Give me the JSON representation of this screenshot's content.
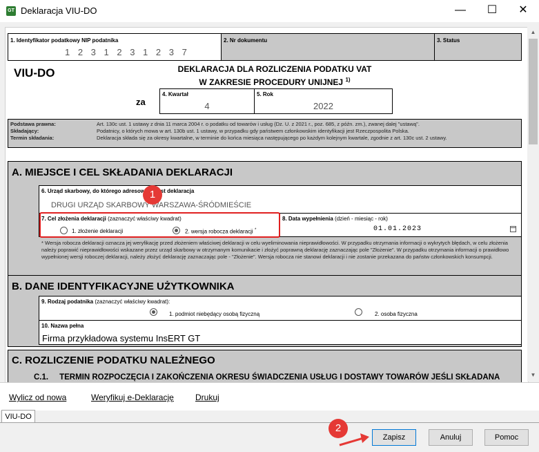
{
  "window": {
    "title": "Deklaracja VIU-DO",
    "icon_text": "GT"
  },
  "form": {
    "field1_label": "1. Identyfikator podatkowy NIP podatnika",
    "field1_value": "1 2 3 1 2 3 1 2 3 7",
    "field2_label": "2. Nr dokumentu",
    "field3_label": "3. Status",
    "form_code": "VIU-DO",
    "title_line1": "DEKLARACJA DLA ROZLICZENIA PODATKU VAT",
    "title_line2": "W ZAKRESIE PROCEDURY UNIJNEJ",
    "title_sup": "1)",
    "za": "za",
    "field4_label": "4. Kwartał",
    "field4_value": "4",
    "field5_label": "5. Rok",
    "field5_value": "2022",
    "legal_basis_label": "Podstawa prawna:",
    "legal_basis_text": "Art. 130c ust. 1 ustawy z dnia 11 marca 2004 r. o podatku od towarów i usług (Dz. U. z 2021 r., poz. 685, z późn. zm.), zwanej dalej \"ustawą\".",
    "filer_label": "Składający:",
    "filer_text": "Podatnicy, o których mowa w art. 130b ust. 1 ustawy, w przypadku gdy państwem członkowskim identyfikacji jest Rzeczpospolita Polska.",
    "deadline_label": "Termin składania:",
    "deadline_text": "Deklaracja składa się za okresy kwartalne, w terminie do końca miesiąca następującego po każdym kolejnym kwartale, zgodnie z art. 130c ust. 2 ustawy.",
    "section_a": "A. MIEJSCE I CEL SKŁADANIA DEKLARACJI",
    "field6_label": "6. Urząd skarbowy, do którego adresowana jest deklaracja",
    "field6_value": "DRUGI URZĄD SKARBOWY WARSZAWA-ŚRÓDMIEŚCIE",
    "field7_label": "7. Cel złożenia deklaracji",
    "field7_hint": "(zaznaczyć właściwy kwadrat)",
    "field7_opt1": "1. złożenie deklaracji",
    "field7_opt2": "2. wersja robocza deklaracji",
    "field7_opt2_sup": "*",
    "field8_label": "8. Data wypełnienia",
    "field8_hint": "(dzień - miesiąc - rok)",
    "field8_value": "01.01.2023",
    "note_text": "* Wersja robocza deklaracji oznacza jej weryfikację przed złożeniem właściwej deklaracji w celu wyeliminowania nieprawidłowości. W przypadku otrzymania informacji o wykrytych błędach, w celu złożenia należy poprawić nieprawidłowości wskazane przez urząd skarbowy w otrzymanym komunikacie i złożyć poprawną deklarację zaznaczając pole \"Złożenie\". W przypadku otrzymania informacji o prawidłowo wypełnionej wersji roboczej deklaracji, należy złożyć deklarację zaznaczając pole - \"Złożenie\". Wersja robocza nie stanowi deklaracji i nie zostanie przekazana do państw członkowskich konsumpcji.",
    "section_b": "B. DANE IDENTYFIKACYJNE UŻYTKOWNIKA",
    "field9_label": "9. Rodzaj podatnika",
    "field9_hint": "(zaznaczyć właściwy kwadrat):",
    "field9_opt1": "1. podmiot niebędący osobą fizyczną",
    "field9_opt2": "2. osoba fizyczna",
    "field10_label": "10. Nazwa pełna",
    "field10_value": "Firma przykładowa systemu InsERT GT",
    "section_c": "C. ROZLICZENIE PODATKU NALEŻNEGO",
    "section_c1": "C.1.     TERMIN ROZPOCZĘCIA I ZAKOŃCZENIA OKRESU ŚWIADCZENIA USŁUG I DOSTAWY TOWARÓW JEŚLI SKŁADANA"
  },
  "links": {
    "calculate": "Wylicz od nowa",
    "verify": "Weryfikuj e-Deklarację",
    "print": "Drukuj"
  },
  "tab": "VIU-DO",
  "buttons": {
    "save": "Zapisz",
    "cancel": "Anuluj",
    "help": "Pomoc"
  },
  "annotations": {
    "badge1": "1",
    "badge2": "2"
  },
  "colors": {
    "annotation_red": "#e02020",
    "badge_red": "#e53935",
    "grey_cell": "#c8c8c8"
  }
}
